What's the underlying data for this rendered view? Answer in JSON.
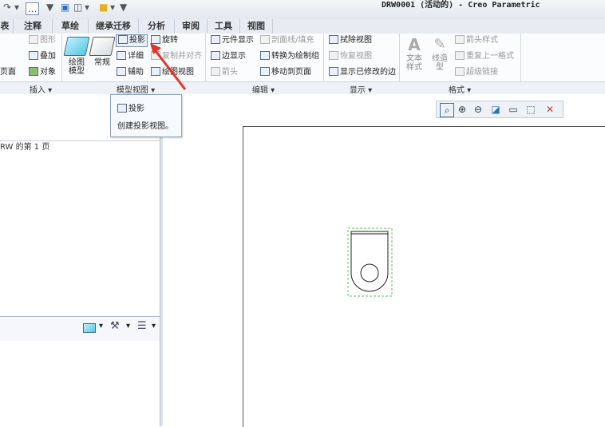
{
  "window": {
    "title": "DRW0001 (活动的) - Creo Parametric"
  },
  "quick_access": {
    "item1": "...",
    "item2": "▼"
  },
  "tabs": [
    "表",
    "注释",
    "草绘",
    "继承迁移",
    "分析",
    "审阅",
    "工具",
    "视图"
  ],
  "ribbon": {
    "insert_group": {
      "items": [
        "图形",
        "叠加",
        "对象"
      ],
      "label": "插入 ▾",
      "partial_left": "页面"
    },
    "model_view_group": {
      "big_button_1": "绘图\n模型",
      "big_button_2": "常规",
      "items": [
        "投影",
        "详细",
        "辅助",
        "旋转",
        "复制并对齐",
        "绘图视图"
      ],
      "label": "模型视图 ▾"
    },
    "edit_group": {
      "items": [
        "元件显示",
        "边显示",
        "箭头",
        "剖面线/填充",
        "转换为绘制组",
        "移动到页面"
      ],
      "label": "编辑 ▾"
    },
    "display_group": {
      "items": [
        "拭除视图",
        "恢复视图",
        "显示已修改的边"
      ],
      "label": "显示 ▾"
    },
    "format_group": {
      "big_button_1": "文本\n样式",
      "big_button_2": "线造\n型",
      "items": [
        "箭头样式",
        "重复上一格式",
        "超级链接"
      ],
      "label": "格式 ▾"
    }
  },
  "tooltip": {
    "title": "投影",
    "description": "创建投影视图。"
  },
  "left_panel": {
    "page_text": "RW 的第 1 页"
  },
  "colors": {
    "accent_cyan": "#58c7e3",
    "arrow_red": "#e2342b",
    "selection_green": "#5fc35f"
  }
}
